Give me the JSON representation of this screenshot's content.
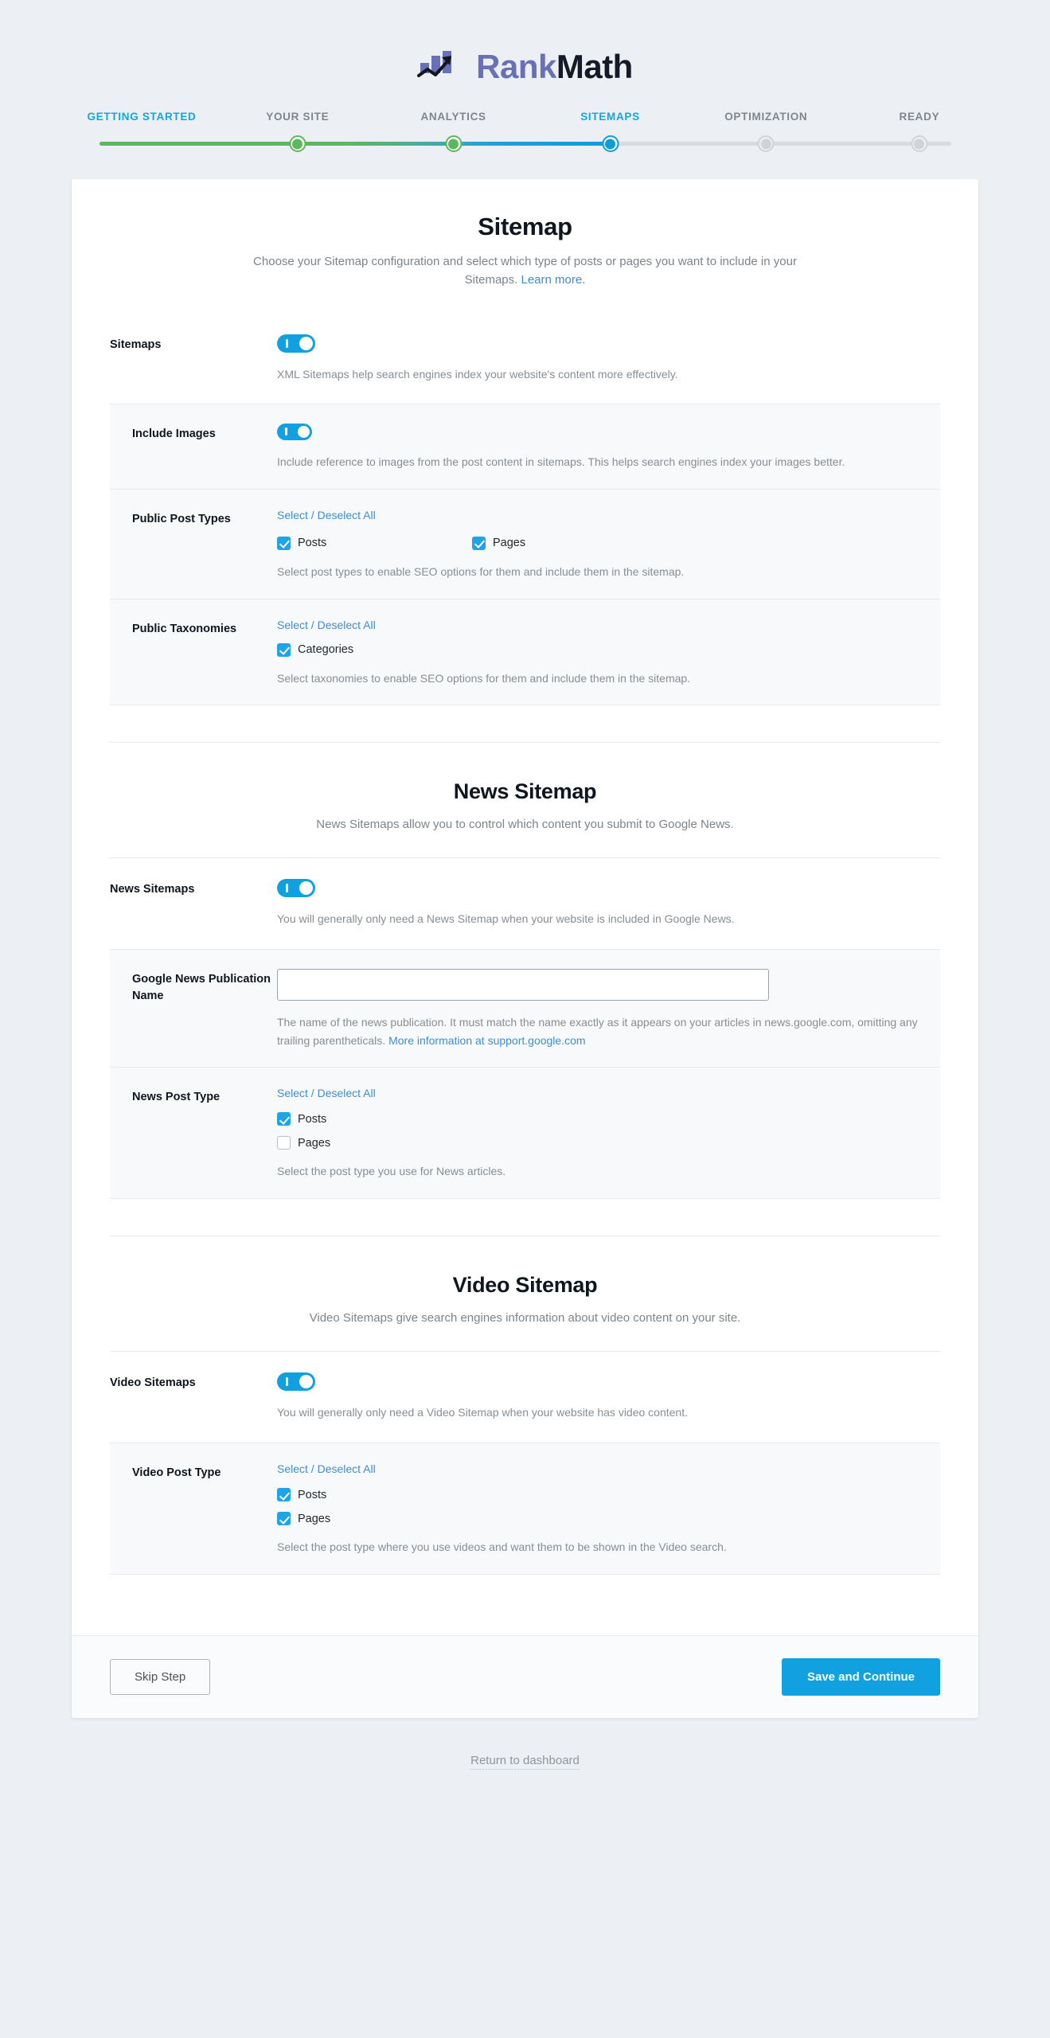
{
  "brand": {
    "name_part1": "Rank",
    "name_part2": "Math",
    "logo_icon": "rankmath-bars-arrow-logo",
    "accent_purple": "#6871b8",
    "accent_blue": "#11a1e0",
    "accent_green": "#5cb85c",
    "link_blue": "#3e8ed0"
  },
  "stepper": {
    "steps": [
      {
        "label": "GETTING STARTED",
        "state": "done"
      },
      {
        "label": "YOUR SITE",
        "state": "done"
      },
      {
        "label": "ANALYTICS",
        "state": "done"
      },
      {
        "label": "SITEMAPS",
        "state": "current"
      },
      {
        "label": "OPTIMIZATION",
        "state": "upcoming"
      },
      {
        "label": "READY",
        "state": "upcoming"
      }
    ]
  },
  "sitemap_section": {
    "title": "Sitemap",
    "description": "Choose your Sitemap configuration and select which type of posts or pages you want to include in your Sitemaps.",
    "learn_more": "Learn more.",
    "sitemaps_row": {
      "label": "Sitemaps",
      "toggle_state": "on",
      "description": "XML Sitemaps help search engines index your website's content more effectively."
    },
    "include_images_row": {
      "label": "Include Images",
      "toggle_state": "on",
      "description": "Include reference to images from the post content in sitemaps. This helps search engines index your images better."
    },
    "public_post_types_row": {
      "label": "Public Post Types",
      "select_all": "Select / Deselect All",
      "options": [
        {
          "label": "Posts",
          "checked": true
        },
        {
          "label": "Pages",
          "checked": true
        }
      ],
      "description": "Select post types to enable SEO options for them and include them in the sitemap."
    },
    "public_taxonomies_row": {
      "label": "Public Taxonomies",
      "select_all": "Select / Deselect All",
      "options": [
        {
          "label": "Categories",
          "checked": true
        }
      ],
      "description": "Select taxonomies to enable SEO options for them and include them in the sitemap."
    }
  },
  "news_section": {
    "title": "News Sitemap",
    "description": "News Sitemaps allow you to control which content you submit to Google News.",
    "news_sitemaps_row": {
      "label": "News Sitemaps",
      "toggle_state": "on",
      "description": "You will generally only need a News Sitemap when your website is included in Google News."
    },
    "publication_name_row": {
      "label": "Google News Publication Name",
      "value": "",
      "placeholder": "",
      "description_part1": "The name of the news publication. It must match the name exactly as it appears on your articles in news.google.com, omitting any trailing parentheticals. ",
      "description_link": "More information at support.google.com"
    },
    "news_post_type_row": {
      "label": "News Post Type",
      "select_all": "Select / Deselect All",
      "options": [
        {
          "label": "Posts",
          "checked": true
        },
        {
          "label": "Pages",
          "checked": false
        }
      ],
      "description": "Select the post type you use for News articles."
    }
  },
  "video_section": {
    "title": "Video Sitemap",
    "description": "Video Sitemaps give search engines information about video content on your site.",
    "video_sitemaps_row": {
      "label": "Video Sitemaps",
      "toggle_state": "on",
      "description": "You will generally only need a Video Sitemap when your website has video content."
    },
    "video_post_type_row": {
      "label": "Video Post Type",
      "select_all": "Select / Deselect All",
      "options": [
        {
          "label": "Posts",
          "checked": true
        },
        {
          "label": "Pages",
          "checked": true
        }
      ],
      "description": "Select the post type where you use videos and want them to be shown in the Video search."
    }
  },
  "footer": {
    "skip_label": "Skip Step",
    "save_label": "Save and Continue",
    "return_label": "Return to dashboard"
  }
}
